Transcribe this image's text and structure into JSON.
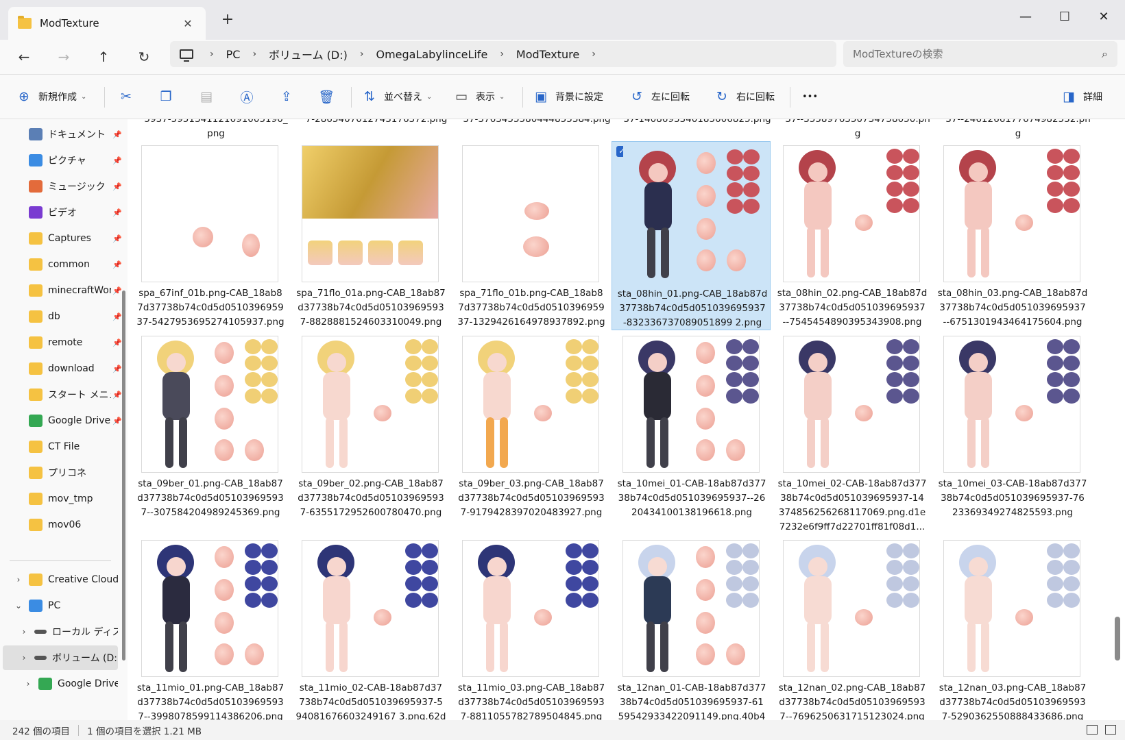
{
  "window": {
    "tab_title": "ModTexture",
    "new_tab": "+",
    "minimize": "—",
    "maximize": "☐",
    "close": "✕"
  },
  "nav": {
    "back": "←",
    "forward": "→",
    "up": "↑",
    "refresh": "↻",
    "breadcrumbs": [
      "PC",
      "ボリューム (D:)",
      "OmegaLabylinceLife",
      "ModTexture"
    ],
    "search_placeholder": "ModTextureの検索"
  },
  "commands": {
    "new": "新規作成",
    "sort": "並べ替え",
    "view": "表示",
    "set_background": "背景に設定",
    "rotate_left": "左に回転",
    "rotate_right": "右に回転",
    "more": "•••",
    "details": "詳細"
  },
  "sidebar": {
    "items": [
      {
        "label": "ドキュメント",
        "icon": "documents-icon",
        "color": "#5b7fb5",
        "pinned": true
      },
      {
        "label": "ピクチャ",
        "icon": "pictures-icon",
        "color": "#3b8ce3",
        "pinned": true
      },
      {
        "label": "ミュージック",
        "icon": "music-icon",
        "color": "#e36b3b",
        "pinned": true
      },
      {
        "label": "ビデオ",
        "icon": "videos-icon",
        "color": "#7a3bd1",
        "pinned": true
      },
      {
        "label": "Captures",
        "icon": "folder-icon",
        "color": "#f5c242",
        "pinned": true
      },
      {
        "label": "common",
        "icon": "folder-icon",
        "color": "#f5c242",
        "pinned": true
      },
      {
        "label": "minecraftWorld",
        "icon": "folder-icon",
        "color": "#f5c242",
        "pinned": true
      },
      {
        "label": "db",
        "icon": "folder-icon",
        "color": "#f5c242",
        "pinned": true
      },
      {
        "label": "remote",
        "icon": "folder-icon",
        "color": "#f5c242",
        "pinned": true
      },
      {
        "label": "download",
        "icon": "folder-icon",
        "color": "#f5c242",
        "pinned": true
      },
      {
        "label": "スタート メニュー",
        "icon": "folder-icon",
        "color": "#f5c242",
        "pinned": true
      },
      {
        "label": "Google Drive",
        "icon": "google-drive-icon",
        "color": "#34a853",
        "pinned": true
      },
      {
        "label": "CT File",
        "icon": "folder-icon",
        "color": "#f5c242",
        "pinned": false
      },
      {
        "label": "プリコネ",
        "icon": "folder-icon",
        "color": "#f5c242",
        "pinned": false
      },
      {
        "label": "mov_tmp",
        "icon": "folder-icon",
        "color": "#f5c242",
        "pinned": false
      },
      {
        "label": "mov06",
        "icon": "folder-icon",
        "color": "#f5c242",
        "pinned": false
      }
    ],
    "tree": [
      {
        "label": "Creative Cloud Files",
        "icon": "folder-icon",
        "color": "#f5c242",
        "chevron": "›"
      },
      {
        "label": "PC",
        "icon": "pc-icon",
        "color": "#3b8ce3",
        "chevron": "⌄"
      },
      {
        "label": "ローカル ディスク (C:)",
        "icon": "drive-icon",
        "color": "#555555",
        "chevron": "›"
      },
      {
        "label": "ボリューム (D:)",
        "icon": "drive-icon",
        "color": "#555555",
        "chevron": "›"
      },
      {
        "label": "Google Drive (G:)",
        "icon": "google-drive-icon",
        "color": "#34a853",
        "chevron": "›"
      }
    ],
    "pin_glyph": "📌"
  },
  "files": {
    "top_partial": [
      [
        "5937-5951341121691005190_",
        "png"
      ],
      [
        "7-2865407012743176372.png",
        ""
      ],
      [
        "37-3763455580444855384.png",
        ""
      ],
      [
        "37-1408693340185006825.png",
        ""
      ],
      [
        "37--3558976350734758050.pn",
        "g"
      ],
      [
        "37--2461266177674982532.pn",
        "g"
      ]
    ],
    "rows": [
      [
        {
          "name": [
            "spa_67inf_01b.png-CAB_18ab8",
            "7d37738b74c0d5d0510396959",
            "37-5427953695274105937.png"
          ],
          "art": "blobs2"
        },
        {
          "name": [
            "spa_71flo_01a.png-CAB_18ab87",
            "d37738b74c0d5d05103969593",
            "7-8828881524603310049.png"
          ],
          "art": "banner"
        },
        {
          "name": [
            "spa_71flo_01b.png-CAB_18ab8",
            "7d37738b74c0d5d0510396959",
            "37-1329426164978937892.png"
          ],
          "art": "blobs2c"
        },
        {
          "name": [
            "sta_08hin_01.png-CAB_18ab87d",
            "37738b74c0d5d051039695937",
            "-832336737089051899 2.png"
          ],
          "art": "char-red",
          "selected": true
        },
        {
          "name": [
            "sta_08hin_02.png-CAB_18ab87d",
            "37738b74c0d5d051039695937",
            "--7545454890395343908.png"
          ],
          "art": "char-red-b"
        },
        {
          "name": [
            "sta_08hin_03.png-CAB_18ab87d",
            "37738b74c0d5d051039695937",
            "--6751301943464175604.png"
          ],
          "art": "char-red-c"
        }
      ],
      [
        {
          "name": [
            "sta_09ber_01.png-CAB_18ab87",
            "d37738b74c0d5d05103969593",
            "7--307584204989245369.png"
          ],
          "art": "char-blonde"
        },
        {
          "name": [
            "sta_09ber_02.png-CAB_18ab87",
            "d37738b74c0d5d05103969593",
            "7-6355172952600780470.png"
          ],
          "art": "char-blonde-b"
        },
        {
          "name": [
            "sta_09ber_03.png-CAB_18ab87",
            "d37738b74c0d5d05103969593",
            "7-9179428397020483927.png"
          ],
          "art": "char-blonde-c"
        },
        {
          "name": [
            "sta_10mei_01-CAB-18ab87d377",
            "38b74c0d5d051039695937--26",
            "20434100138196618.png"
          ],
          "art": "char-dark"
        },
        {
          "name": [
            "sta_10mei_02-CAB-18ab87d377",
            "38b74c0d5d051039695937-14",
            "374856256268117069.png.d1e",
            "7232e6f9ff7d22701ff81f08d1..."
          ],
          "art": "char-dark-b"
        },
        {
          "name": [
            "sta_10mei_03-CAB-18ab87d377",
            "38b74c0d5d051039695937-76",
            "23369349274825593.png"
          ],
          "art": "char-dark-c"
        }
      ],
      [
        {
          "name": [
            "sta_11mio_01.png-CAB_18ab87",
            "d37738b74c0d5d05103969593",
            "7--3998078599114386206.png"
          ],
          "art": "char-navy"
        },
        {
          "name": [
            "sta_11mio_02-CAB-18ab87d37",
            "738b74c0d5d051039695937-5",
            "94081676603249167 3.png.62d"
          ],
          "art": "char-navy-b"
        },
        {
          "name": [
            "sta_11mio_03.png-CAB_18ab87",
            "d37738b74c0d5d05103969593",
            "7-8811055782789504845.png"
          ],
          "art": "char-navy-c"
        },
        {
          "name": [
            "sta_12nan_01-CAB-18ab87d377",
            "38b74c0d5d051039695937-61",
            "59542933422091149.png.40b4"
          ],
          "art": "char-silver"
        },
        {
          "name": [
            "sta_12nan_02.png-CAB_18ab87",
            "d37738b74c0d5d05103969593",
            "7--7696250631715123024.png"
          ],
          "art": "char-silver-b"
        },
        {
          "name": [
            "sta_12nan_03.png-CAB_18ab87",
            "d37738b74c0d5d05103969593",
            "7-5290362550888433686.png"
          ],
          "art": "char-silver-c"
        }
      ]
    ]
  },
  "status": {
    "count": "242 個の項目",
    "selection": "1 個の項目を選択  1.21 MB"
  }
}
